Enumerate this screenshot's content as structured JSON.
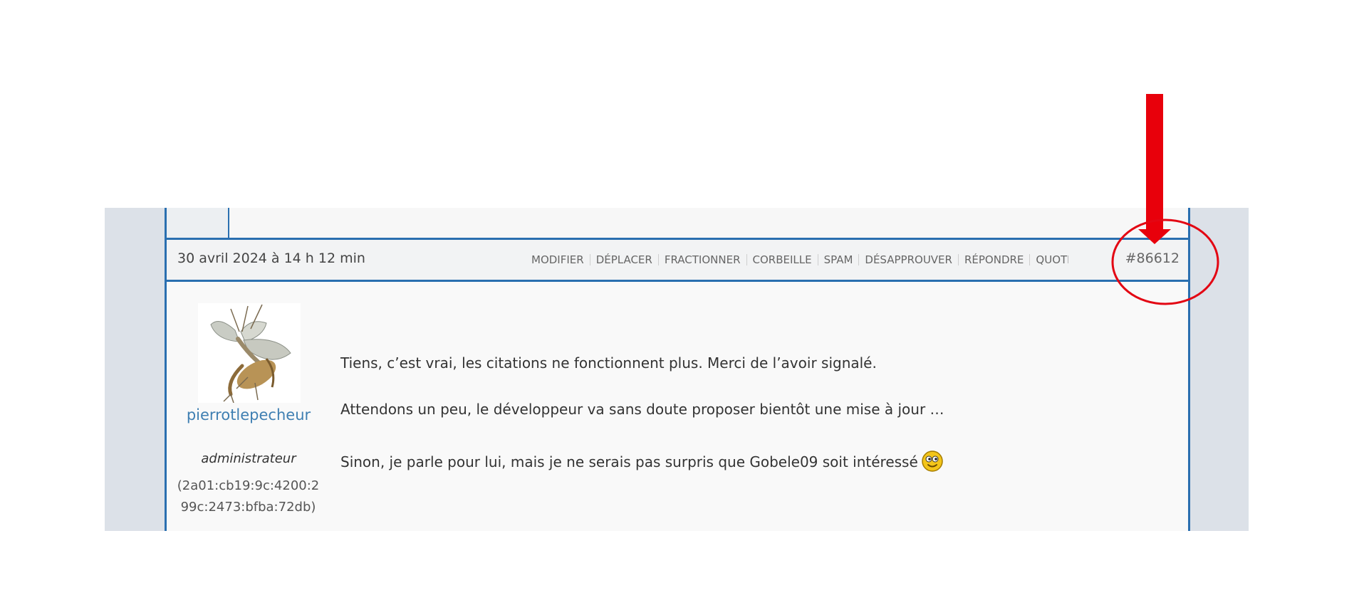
{
  "post": {
    "date": "30 avril 2024 à 14 h 12 min",
    "actions": [
      "MODIFIER",
      "DÉPLACER",
      "FRACTIONNER",
      "CORBEILLE",
      "SPAM",
      "DÉSAPPROUVER",
      "RÉPONDRE",
      "QUOTE"
    ],
    "number": "#86612"
  },
  "author": {
    "name": "pierrotlepecheur",
    "role": "administrateur",
    "ip": "(2a01:cb19:9c:4200:299c:2473:bfba:72db)"
  },
  "content": {
    "paragraphs": [
      "Tiens, c’est vrai, les citations ne fonctionnent plus. Merci de l’avoir signalé.",
      "Attendons un peu, le développeur va sans doute proposer bientôt une mise à jour …",
      "Sinon, je parle pour lui, mais je ne serais pas surpris que Gobele09 soit intéressé"
    ]
  },
  "icons": {
    "avatar": "mayfly-avatar-image",
    "smiley": "wink-smiley-icon",
    "arrow": "red-arrow-down-icon",
    "circle": "red-circle-annotation"
  },
  "colors": {
    "border": "#2a6fb0",
    "author_link": "#3f7fb2",
    "annotation": "#e8000b",
    "page_bg": "#dce1e8"
  }
}
